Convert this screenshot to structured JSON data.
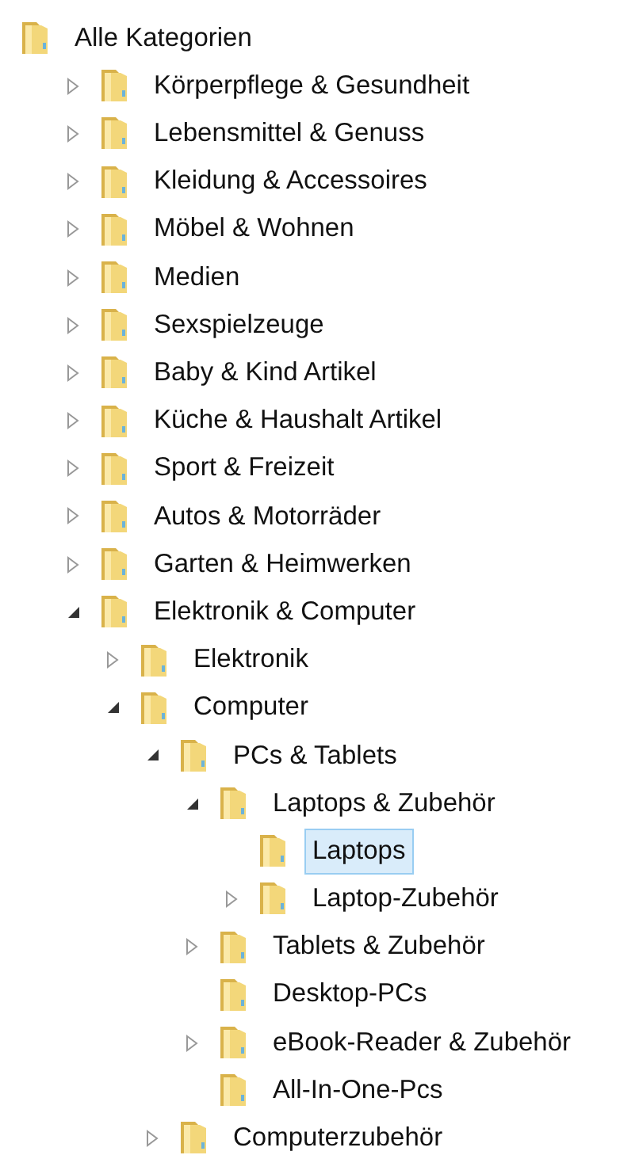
{
  "tree": {
    "label": "Alle Kategorien",
    "kind": "root",
    "selected": false,
    "children": [
      {
        "label": "Körperpflege & Gesundheit",
        "kind": "branch",
        "expanded": false,
        "selected": false
      },
      {
        "label": "Lebensmittel & Genuss",
        "kind": "branch",
        "expanded": false,
        "selected": false
      },
      {
        "label": "Kleidung & Accessoires",
        "kind": "branch",
        "expanded": false,
        "selected": false
      },
      {
        "label": "Möbel & Wohnen",
        "kind": "branch",
        "expanded": false,
        "selected": false
      },
      {
        "label": "Medien",
        "kind": "branch",
        "expanded": false,
        "selected": false
      },
      {
        "label": "Sexspielzeuge",
        "kind": "branch",
        "expanded": false,
        "selected": false
      },
      {
        "label": "Baby & Kind Artikel",
        "kind": "branch",
        "expanded": false,
        "selected": false
      },
      {
        "label": "Küche & Haushalt Artikel",
        "kind": "branch",
        "expanded": false,
        "selected": false
      },
      {
        "label": "Sport & Freizeit",
        "kind": "branch",
        "expanded": false,
        "selected": false
      },
      {
        "label": "Autos & Motorräder",
        "kind": "branch",
        "expanded": false,
        "selected": false
      },
      {
        "label": "Garten & Heimwerken",
        "kind": "branch",
        "expanded": false,
        "selected": false
      },
      {
        "label": "Elektronik & Computer",
        "kind": "branch",
        "expanded": true,
        "selected": false,
        "children": [
          {
            "label": "Elektronik",
            "kind": "branch",
            "expanded": false,
            "selected": false
          },
          {
            "label": "Computer",
            "kind": "branch",
            "expanded": true,
            "selected": false,
            "children": [
              {
                "label": "PCs & Tablets",
                "kind": "branch",
                "expanded": true,
                "selected": false,
                "children": [
                  {
                    "label": "Laptops & Zubehör",
                    "kind": "branch",
                    "expanded": true,
                    "selected": false,
                    "children": [
                      {
                        "label": "Laptops",
                        "kind": "leaf",
                        "selected": true
                      },
                      {
                        "label": "Laptop-Zubehör",
                        "kind": "branch",
                        "expanded": false,
                        "selected": false
                      }
                    ]
                  },
                  {
                    "label": "Tablets & Zubehör",
                    "kind": "branch",
                    "expanded": false,
                    "selected": false
                  },
                  {
                    "label": "Desktop-PCs",
                    "kind": "leaf",
                    "selected": false
                  },
                  {
                    "label": "eBook-Reader & Zubehör",
                    "kind": "branch",
                    "expanded": false,
                    "selected": false
                  },
                  {
                    "label": "All-In-One-Pcs",
                    "kind": "leaf",
                    "selected": false
                  }
                ]
              },
              {
                "label": "Computerzubehör",
                "kind": "branch",
                "expanded": false,
                "selected": false
              }
            ]
          }
        ]
      }
    ]
  }
}
